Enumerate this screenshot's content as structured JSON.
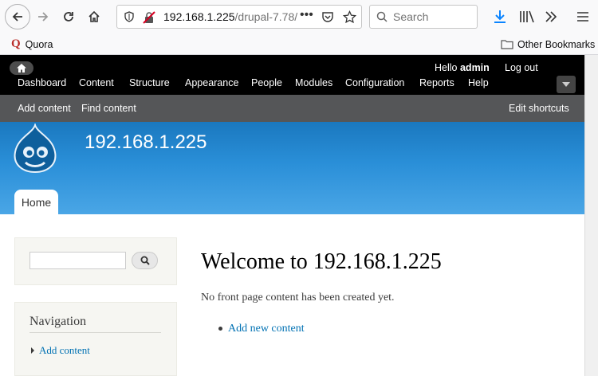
{
  "browser": {
    "url_host": "192.168.1.225",
    "url_path": "/drupal-7.78/",
    "search_placeholder": "Search",
    "bookmarks": [
      {
        "label": "Quora"
      }
    ],
    "other_bookmarks": "Other Bookmarks"
  },
  "admin_toolbar": {
    "hello_prefix": "Hello",
    "username": "admin",
    "logout": "Log out",
    "menu": [
      "Dashboard",
      "Content",
      "Structure",
      "Appearance",
      "People",
      "Modules",
      "Configuration",
      "Reports",
      "Help"
    ]
  },
  "shortcuts": {
    "items": [
      "Add content",
      "Find content"
    ],
    "edit": "Edit shortcuts"
  },
  "header": {
    "site_name": "192.168.1.225",
    "tab": "Home"
  },
  "sidebar": {
    "navigation_title": "Navigation",
    "navigation_link": "Add content"
  },
  "main": {
    "title": "Welcome to 192.168.1.225",
    "message": "No front page content has been created yet.",
    "link": "Add new content"
  },
  "colors": {
    "link": "#0071b3",
    "header_blue": "#2a8fd8",
    "toolbar_black": "#000000",
    "shortcut_gray": "#555658"
  }
}
